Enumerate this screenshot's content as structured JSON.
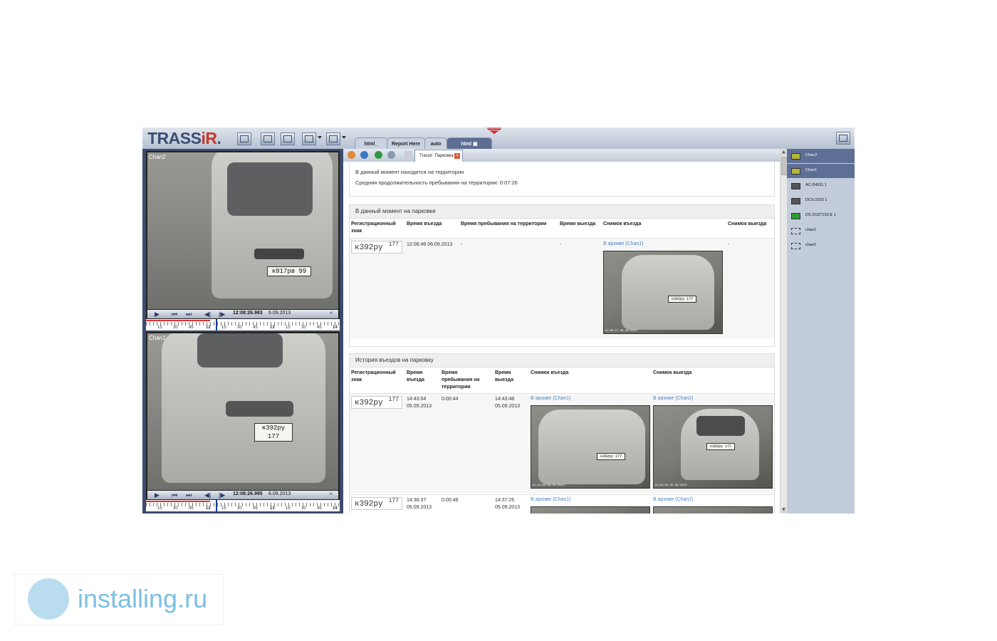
{
  "app": {
    "logo_main": "TRASS",
    "logo_accent": "iR",
    "logo_tail": "."
  },
  "tabs": [
    {
      "label": "html_"
    },
    {
      "label": "Report Here"
    },
    {
      "label": "auto"
    },
    {
      "label": "html"
    }
  ],
  "cameras": [
    {
      "label": "Chan2",
      "plate": "к817рв 99",
      "time": "12:08:26.983",
      "date": "6.09.2013",
      "scale": [
        "15",
        "30",
        "45",
        "12",
        "15",
        "30",
        "45",
        "13",
        "15",
        "30",
        "45",
        "14"
      ]
    },
    {
      "label": "Chan1",
      "plate": "к392ру 177",
      "time": "12:08:26.995",
      "date": "6.09.2013",
      "scale": [
        "15",
        "30",
        "45",
        "12",
        "15",
        "30",
        "45",
        "13",
        "15",
        "30",
        "45",
        "14"
      ]
    }
  ],
  "page_tab": {
    "label": "Trassir: Парковка"
  },
  "summary": {
    "line1": "В данный момент находится на территории",
    "line2": "Средняя продолжительность пребывания на территории: 0:07:26"
  },
  "current": {
    "title": "В данный момент на парковке",
    "headers": [
      "Регистрационный знак",
      "Время въезда",
      "Время пребывания на территории",
      "Время выезда",
      "Снимок въезда",
      "Снимок выезда"
    ],
    "row": {
      "plate_num": "к392ру",
      "plate_reg": "177",
      "entry": "12:08:46 06.09.2013",
      "duration": "-",
      "exit": "-",
      "link": "В архиве (Chan1)",
      "exit_snap": "-",
      "snap_cap": "12:08:47 06.09.2013",
      "snap_plate": "к392ру 177"
    }
  },
  "history": {
    "title": "История въездов на парковку",
    "headers": [
      "Регистрационный знак",
      "Время въезда",
      "Время пребывания на территории",
      "Время выезда",
      "Снимок въезда",
      "Снимок выезда"
    ],
    "rows": [
      {
        "plate_num": "к392ру",
        "plate_reg": "177",
        "entry_time": "14:43:04",
        "entry_date": "05.09.2013",
        "duration": "0:00:44",
        "exit_time": "14:43:48",
        "exit_date": "05.09.2013",
        "link_in": "В архиве (Chan1)",
        "link_out": "В архиве (Chan2)",
        "cap_in": "14:43:04 05.09.2013",
        "cap_out": "14:43:48 05.09.2013",
        "snap_plate_in": "к392ру 177",
        "snap_plate_out": "к392ру 177"
      },
      {
        "plate_num": "к392ру",
        "plate_reg": "177",
        "entry_time": "14:36:37",
        "entry_date": "05.09.2013",
        "duration": "0:00:48",
        "exit_time": "14:37:25",
        "exit_date": "05.09.2013",
        "link_in": "В архиве (Chan1)",
        "link_out": "В архиве (Chan2)"
      }
    ]
  },
  "channels": [
    {
      "label": "Chan2",
      "icon": "camera-icon"
    },
    {
      "label": "Chan1",
      "icon": "camera-icon"
    },
    {
      "label": "AC-D4011 1",
      "icon": "camera-icon"
    },
    {
      "label": "DCS-2103 1",
      "icon": "camera-icon"
    },
    {
      "label": "DS-2CD7153-E 1",
      "icon": "camera-icon"
    },
    {
      "label": "chan1",
      "icon": "camera-placeholder-icon"
    },
    {
      "label": "chan2",
      "icon": "camera-placeholder-icon"
    }
  ],
  "watermark": {
    "text": "installing.ru"
  },
  "colors": {
    "accent": "#5d6d93",
    "link": "#4a86c5",
    "logo_red": "#c53a2a"
  }
}
